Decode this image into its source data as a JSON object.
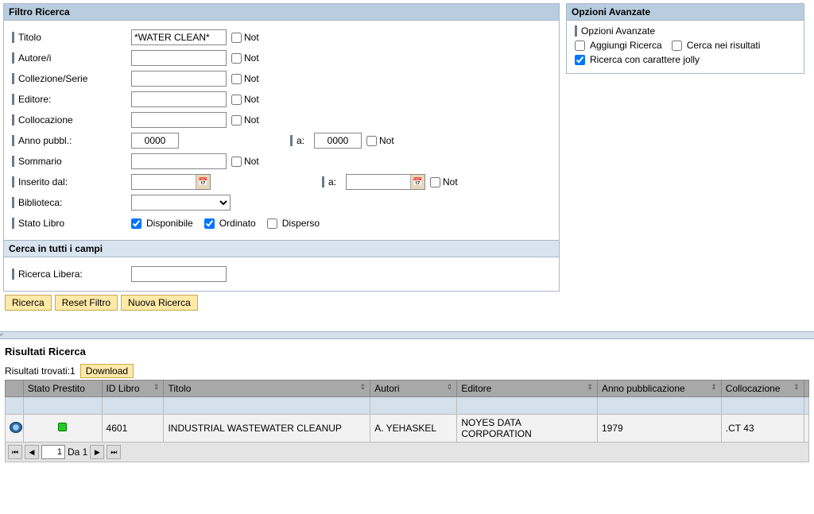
{
  "filter": {
    "header": "Filtro Ricerca",
    "labels": {
      "titolo": "Titolo",
      "autore": "Autore/i",
      "collezione": "Collezione/Serie",
      "editore": "Editore:",
      "collocazione": "Collocazione",
      "annoPubbl": "Anno pubbl.:",
      "annoA": "a:",
      "sommario": "Sommario",
      "inseritoDal": "Inserito dal:",
      "inseritoA": "a:",
      "biblioteca": "Biblioteca:",
      "statoLibro": "Stato Libro"
    },
    "values": {
      "titolo": "*WATER CLEAN*",
      "annoFrom": "0000",
      "annoTo": "0000"
    },
    "not": "Not",
    "status": {
      "disponibile": "Disponibile",
      "ordinato": "Ordinato",
      "disperso": "Disperso"
    },
    "freeSearch": {
      "header": "Cerca in tutti i campi",
      "label": "Ricerca Libera:"
    },
    "buttons": {
      "ricerca": "Ricerca",
      "reset": "Reset Filtro",
      "nuova": "Nuova Ricerca"
    }
  },
  "options": {
    "header": "Opzioni Avanzate",
    "title": "Opzioni Avanzate",
    "aggiungi": "Aggiungi Ricerca",
    "cercaNei": "Cerca nei risultati",
    "jolly": "Ricerca con carattere jolly"
  },
  "results": {
    "title": "Risultati Ricerca",
    "found": "Risultati trovati:1",
    "download": "Download",
    "cols": {
      "statoPrestito": "Stato Prestito",
      "idLibro": "ID Libro",
      "titolo": "Titolo",
      "autori": "Autori",
      "editore": "Editore",
      "anno": "Anno pubblicazione",
      "collocazione": "Collocazione"
    },
    "rows": [
      {
        "id": "4601",
        "titolo": "INDUSTRIAL WASTEWATER CLEANUP",
        "autori": "A. YEHASKEL",
        "editore": "NOYES DATA CORPORATION",
        "anno": "1979",
        "coll": ".CT 43"
      }
    ],
    "pager": {
      "page": "1",
      "of": "Da 1"
    }
  }
}
